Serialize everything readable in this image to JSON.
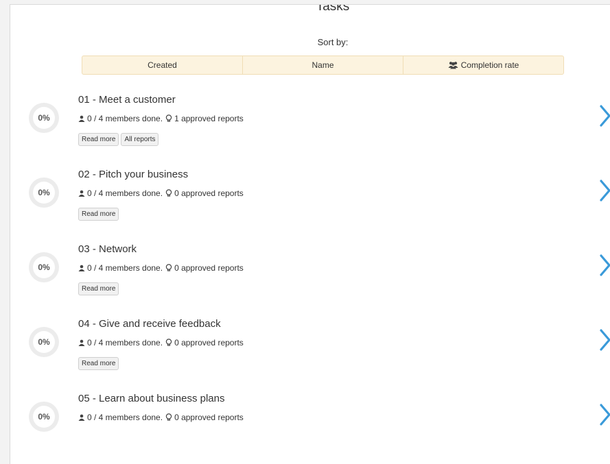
{
  "header": {
    "title": "Tasks",
    "sort_label": "Sort by:"
  },
  "sort_tabs": [
    {
      "label": "Created"
    },
    {
      "label": "Name"
    },
    {
      "label": "Completion rate",
      "icon": "users-icon"
    }
  ],
  "tasks": [
    {
      "title": "01 - Meet a customer",
      "progress": "0%",
      "members": "0 / 4 members done.",
      "reports": "1 approved reports",
      "buttons": [
        "Read more",
        "All reports"
      ]
    },
    {
      "title": "02 - Pitch your business",
      "progress": "0%",
      "members": "0 / 4 members done.",
      "reports": "0 approved reports",
      "buttons": [
        "Read more"
      ]
    },
    {
      "title": "03 - Network",
      "progress": "0%",
      "members": "0 / 4 members done.",
      "reports": "0 approved reports",
      "buttons": [
        "Read more"
      ]
    },
    {
      "title": "04 - Give and receive feedback",
      "progress": "0%",
      "members": "0 / 4 members done.",
      "reports": "0 approved reports",
      "buttons": [
        "Read more"
      ]
    },
    {
      "title": "05 - Learn about business plans",
      "progress": "0%",
      "members": "0 / 4 members done.",
      "reports": "0 approved reports",
      "buttons": []
    }
  ],
  "icons": {
    "member": "user-icon",
    "reports": "lightbulb-icon",
    "next": "chevron-right-icon"
  },
  "colors": {
    "accent": "#3a9ad9",
    "sort_bar_bg": "#fcf3df",
    "sort_bar_border": "#f0ddb5",
    "ring": "#ececec"
  }
}
